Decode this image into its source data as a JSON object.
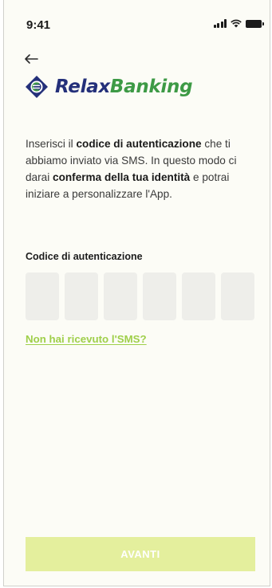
{
  "status_bar": {
    "time": "9:41"
  },
  "logo": {
    "part1": "Relax",
    "part2": "Banking"
  },
  "intro": {
    "t1": "Inserisci il ",
    "b1": "codice di autenticazione",
    "t2": " che ti abbiamo inviato via SMS. In questo modo ci darai ",
    "b2": "conferma della tua identità",
    "t3": " e potrai iniziare a personalizzare l'App."
  },
  "code": {
    "label": "Codice di autenticazione",
    "digits": [
      "",
      "",
      "",
      "",
      "",
      ""
    ]
  },
  "resend_link": "Non hai ricevuto l'SMS?",
  "continue_button": "AVANTI",
  "colors": {
    "brand_blue": "#24307a",
    "brand_green": "#3d9a45",
    "link_green": "#9fcf4a",
    "button_disabled": "#e4ef9d"
  }
}
